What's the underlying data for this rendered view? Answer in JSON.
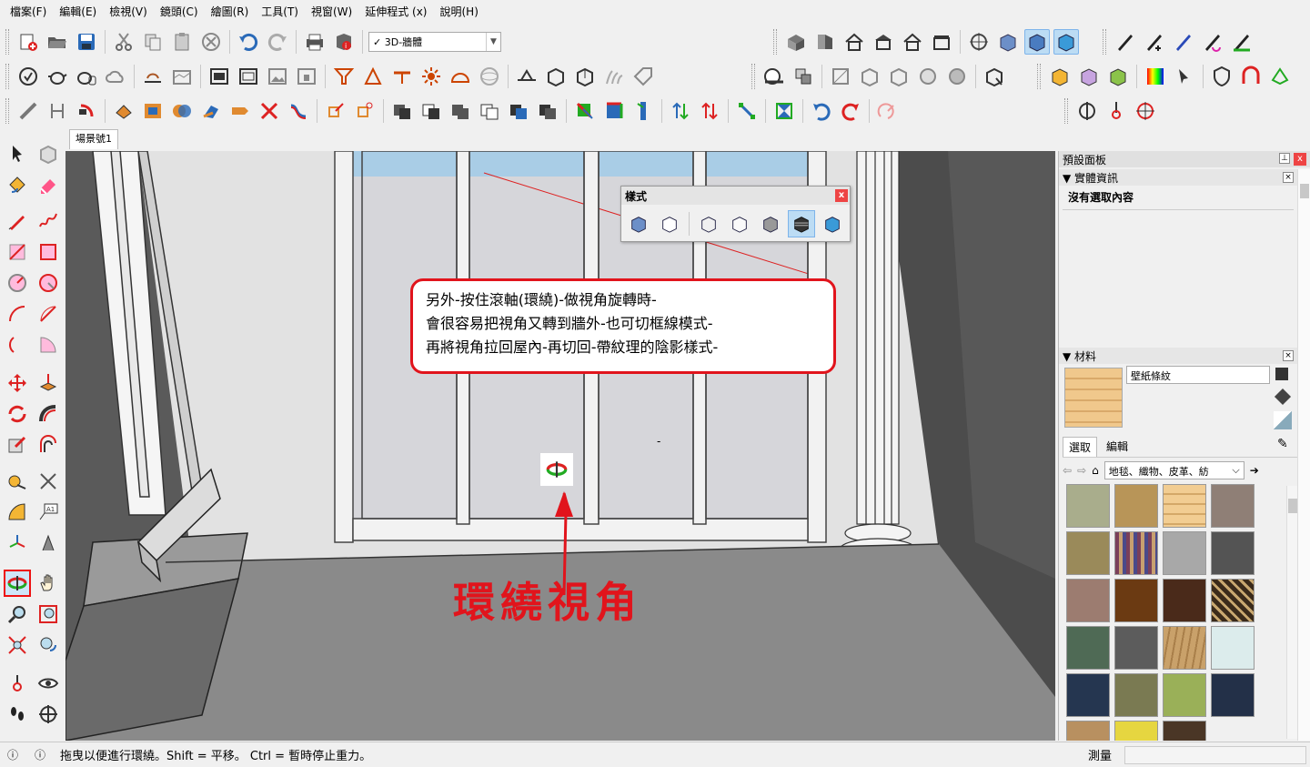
{
  "menu": [
    "檔案(F)",
    "編輯(E)",
    "檢視(V)",
    "鏡頭(C)",
    "繪圖(R)",
    "工具(T)",
    "視窗(W)",
    "延伸程式 (x)",
    "說明(H)"
  ],
  "toolbar": {
    "style_select_value": "3D-牆體",
    "style_select_check": "✓"
  },
  "scene_tab": "場景號1",
  "style_panel": {
    "title": "樣式",
    "close": "x"
  },
  "callout": {
    "line1": "另外-按住滾軸(環繞)-做視角旋轉時-",
    "line2": "會很容易把視角又轉到牆外-也可切框線模式-",
    "line3": "再將視角拉回屋內-再切回-帶紋理的陰影樣式-"
  },
  "annotation_label": "環繞視角",
  "viewport_mark": "-",
  "tray": {
    "title": "預設面板",
    "entity_info": {
      "title": "實體資訊",
      "content": "沒有選取內容"
    },
    "materials": {
      "title": "材料",
      "material_name": "壁紙條紋",
      "tab_select": "選取",
      "tab_edit": "編輯",
      "category": "地毯、織物、皮革、紡"
    }
  },
  "status": {
    "text": "拖曳以便進行環繞。Shift = 平移。 Ctrl = 暫時停止重力。",
    "measure_label": "測量",
    "measure_value": ""
  },
  "colors": {
    "accent_red": "#e1141c",
    "selected_blue": "#bcdcf4"
  }
}
